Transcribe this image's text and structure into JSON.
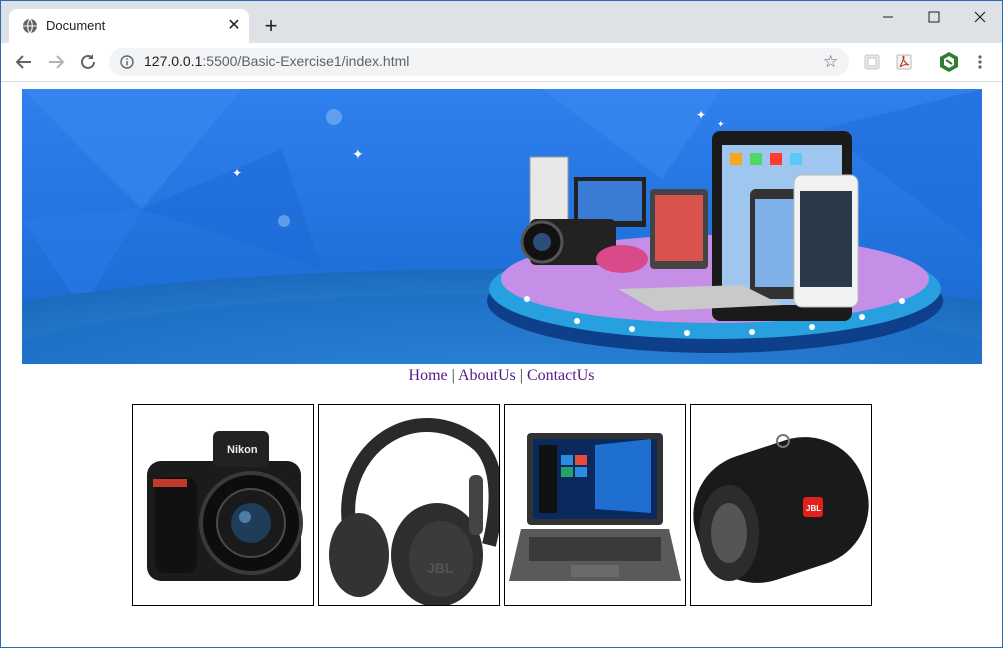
{
  "browser": {
    "tab_title": "Document",
    "close_tab_symbol": "✕",
    "new_tab_symbol": "+",
    "url_host": "127.0.0.1",
    "url_rest": ":5500/Basic-Exercise1/index.html",
    "window_controls": [
      "minimize",
      "maximize",
      "close"
    ],
    "icons": [
      "globe-icon",
      "back-icon",
      "forward-icon",
      "reload-icon",
      "info-icon",
      "star-icon",
      "extension-icon",
      "pdf-icon",
      "profile-icon",
      "menu-icon"
    ]
  },
  "page": {
    "nav": {
      "home": "Home",
      "separator": "|",
      "about": "AboutUs",
      "contact": "ContactUs"
    },
    "banner": {
      "description_icon": "electronics-banner-image"
    },
    "products": [
      {
        "icon": "camera-image"
      },
      {
        "icon": "headphones-image"
      },
      {
        "icon": "laptop-image"
      },
      {
        "icon": "speaker-image"
      }
    ],
    "accent_colors": {
      "banner_blue": "#2f7ee8",
      "platform_purple": "#c58fe8",
      "link_purple": "#551a8b"
    }
  }
}
